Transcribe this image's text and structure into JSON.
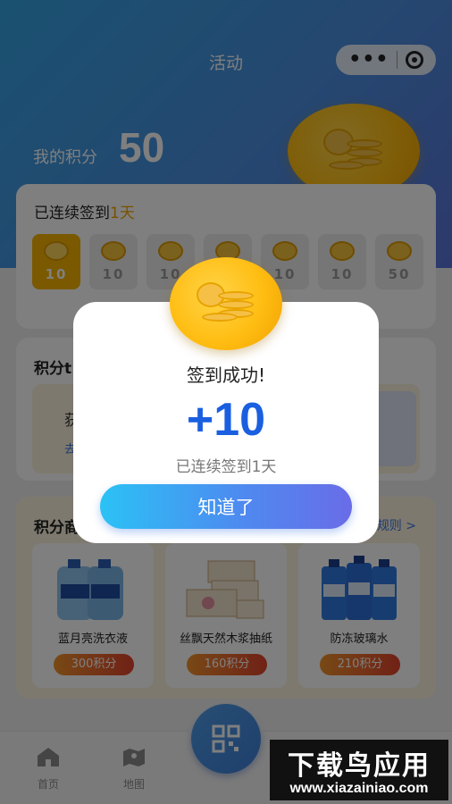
{
  "header": {
    "title": "活动",
    "capsule_more_icon": "more-dots-icon",
    "capsule_close_icon": "target-icon"
  },
  "points": {
    "label": "我的积分",
    "value": "50"
  },
  "checkin": {
    "title_prefix": "已连续签到",
    "streak_text": "1天",
    "days": [
      {
        "value": "10",
        "active": true
      },
      {
        "value": "10",
        "active": false
      },
      {
        "value": "10",
        "active": false
      },
      {
        "value": "10",
        "active": false
      },
      {
        "value": "10",
        "active": false
      },
      {
        "value": "10",
        "active": false
      },
      {
        "value": "50",
        "active": false
      }
    ]
  },
  "tasks": {
    "title": "积分t",
    "earn_text": "获得",
    "look_link": "去看"
  },
  "mall": {
    "title": "积分商",
    "rules_link": "规则 >",
    "products": [
      {
        "name": "蓝月亮洗衣液",
        "price": "300积分"
      },
      {
        "name": "丝飘天然木浆抽纸",
        "price": "160积分"
      },
      {
        "name": "防冻玻璃水",
        "price": "210积分"
      }
    ]
  },
  "tabbar": {
    "items": [
      {
        "label": "首页",
        "icon": "home-icon"
      },
      {
        "label": "地图",
        "icon": "map-icon"
      }
    ],
    "scan_icon": "qr-code-icon"
  },
  "modal": {
    "title": "签到成功!",
    "points_added": "+10",
    "subtitle": "已连续签到1天",
    "button_label": "知道了"
  },
  "watermark": {
    "main": "下载鸟应用",
    "url": "www.xiazainiao.com"
  },
  "colors": {
    "accent": "#1a5fe0",
    "gold": "#f5b300",
    "hero_start": "#34a3e3",
    "hero_end": "#5a72d8"
  }
}
